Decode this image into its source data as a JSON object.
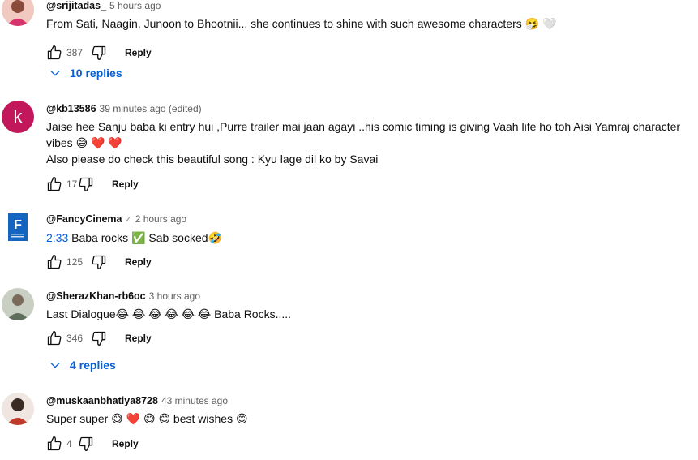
{
  "comments": [
    {
      "author": "@srijitadas_",
      "time": "5 hours ago",
      "verified": false,
      "lines": [
        "From Sati, Naagin, Junoon to Bhootnii... she continues to shine with such awesome characters 🤧 🤍"
      ],
      "likes": "387",
      "reply_label": "Reply",
      "replies": "10 replies"
    },
    {
      "author": "@kb13586",
      "time": "39 minutes ago (edited)",
      "verified": false,
      "avatar_letter": "k",
      "lines": [
        "Jaise hee Sanju baba ki entry hui ,Purre trailer mai jaan agayi ..his  comic timing is giving Vaah life ho toh Aisi Yamraj character",
        "vibes 😅 ❤️ ❤️",
        "Also please do check this  beautiful song : Kyu lage dil ko by Savai"
      ],
      "likes": "17",
      "reply_label": "Reply"
    },
    {
      "author": "@FancyCinema",
      "time": "2 hours ago",
      "verified": true,
      "timestamp": "2:33",
      "lines": [
        "Baba rocks ✅ Sab socked🤣"
      ],
      "likes": "125",
      "reply_label": "Reply"
    },
    {
      "author": "@SherazKhan-rb6oc",
      "time": "3 hours ago",
      "verified": false,
      "lines": [
        "Last Dialogue😂 😂 😂 😂 😂 😂  Baba Rocks....."
      ],
      "likes": "346",
      "reply_label": "Reply",
      "replies": "4 replies"
    },
    {
      "author": "@muskaanbhatiya8728",
      "time": "43 minutes ago",
      "verified": false,
      "lines": [
        "Super super 😅 ❤️ 😅 😊  best wishes  😊"
      ],
      "likes": "4",
      "reply_label": "Reply"
    }
  ],
  "colors": {
    "link": "#065fd4",
    "secondary": "#606060",
    "avatar_k": "#c2185b",
    "fancy_blue": "#1565c0"
  }
}
